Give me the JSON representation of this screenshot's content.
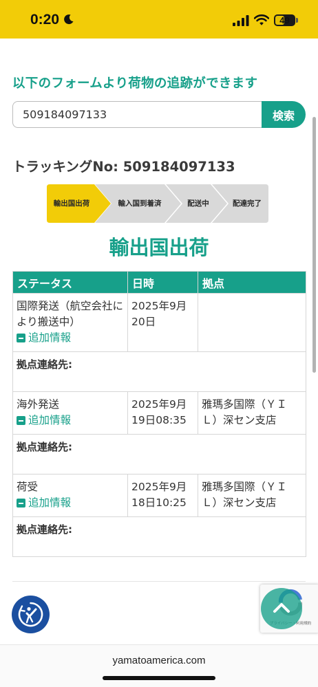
{
  "status_bar": {
    "time": "0:20",
    "battery": "49",
    "battery_level": 0.49
  },
  "page": {
    "heading": "以下のフォームより荷物の追跡ができます",
    "search": {
      "value": "509184097133",
      "button_label": "検索"
    },
    "tracking_label": "トラッキングNo:",
    "tracking_number": "509184097133",
    "steps": [
      {
        "label": "輸出国出荷",
        "active": true
      },
      {
        "label": "輸入国到着済",
        "active": false
      },
      {
        "label": "配送中",
        "active": false
      },
      {
        "label": "配達完了",
        "active": false
      }
    ],
    "current_status": "輸出国出荷",
    "table": {
      "headers": [
        "ステータス",
        "日時",
        "拠点"
      ],
      "more_info_label": "追加情報",
      "contact_label": "拠点連絡先:",
      "rows": [
        {
          "status": "国際発送（航空会社により搬送中）",
          "datetime": "2025年9月20日",
          "location": ""
        },
        {
          "status": "海外発送",
          "datetime": "2025年9月19日08:35",
          "location": "雅瑪多国際（ＹＩＬ）深セン支店"
        },
        {
          "status": "荷受",
          "datetime": "2025年9月18日10:25",
          "location": "雅瑪多国際（ＹＩＬ）深セン支店"
        }
      ]
    }
  },
  "recaptcha_text": "プライバシー・利用規約",
  "browser": {
    "url": "yamatoamerica.com"
  },
  "colors": {
    "accent": "#17a08a",
    "status_bar": "#f2cc08",
    "step_active": "#f2cc08",
    "step_inactive": "#d9d9d9",
    "a11y": "#1b4fa0"
  },
  "icons": [
    "moon-icon",
    "signal-icon",
    "wifi-icon",
    "battery-icon",
    "minus-square-icon",
    "accessibility-icon",
    "recaptcha-icon",
    "chevron-up-icon"
  ]
}
